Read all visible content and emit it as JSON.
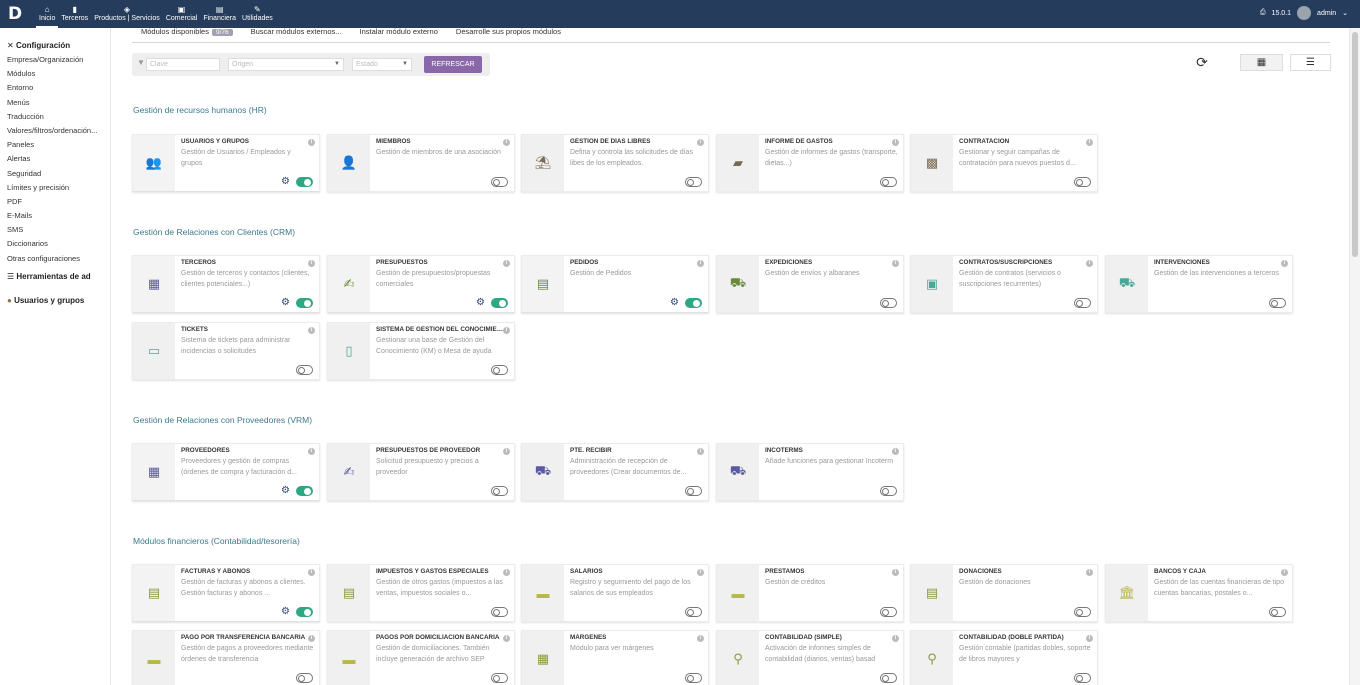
{
  "topbar": {
    "logo": "D",
    "menu": [
      {
        "label": "Inicio",
        "icon": "home-icon",
        "glyph": "⌂"
      },
      {
        "label": "Terceros",
        "icon": "building-icon",
        "glyph": "▮"
      },
      {
        "label": "Productos | Servicios",
        "icon": "cube-icon",
        "glyph": "◈"
      },
      {
        "label": "Comercial",
        "icon": "briefcase-icon",
        "glyph": "▣"
      },
      {
        "label": "Financiera",
        "icon": "money-icon",
        "glyph": "▤"
      },
      {
        "label": "Utilidades",
        "icon": "wrench-icon",
        "glyph": "✎"
      }
    ],
    "version": "15.0.1",
    "user": "admin"
  },
  "sidebar": {
    "section1_title": "Configuración",
    "items": [
      "Empresa/Organización",
      "Módulos",
      "Entorno",
      "Menús",
      "Traducción",
      "Valores/filtros/ordenación...",
      "Paneles",
      "Alertas",
      "Seguridad",
      "Límites y precisión",
      "PDF",
      "E-Mails",
      "SMS",
      "Diccionarios",
      "Otras configuraciones"
    ],
    "section2_title": "Herramientas de ad",
    "section3_title": "Usuarios y grupos"
  },
  "tabs": {
    "available": "Módulos disponibles",
    "available_count": "9/76",
    "external": "Buscar módulos externos...",
    "install": "Instalar módulo externo",
    "develop": "Desarrolle sus propios módulos"
  },
  "filters": {
    "keyword_placeholder": "Clave",
    "origin_placeholder": "Origen",
    "state_placeholder": "Estado",
    "refresh_label": "REFRESCAR"
  },
  "colors": {
    "topbar": "#263c5c",
    "accent": "#8a67a8",
    "toggle_on": "#2da882",
    "section_title": "#3d7a8a"
  },
  "sections": [
    {
      "title": "Gestión de recursos humanos (HR)",
      "cards": [
        {
          "title": "USUARIOS Y GRUPOS",
          "desc": "Gestión de Usuarios / Empleados y grupos",
          "icon": "users-icon",
          "glyph": "👥",
          "color": "#888",
          "enabled": true
        },
        {
          "title": "MIEMBROS",
          "desc": "Gestión de miembros de una asociación",
          "icon": "user-icon",
          "glyph": "👤",
          "color": "#777",
          "enabled": false
        },
        {
          "title": "GESTIÓN DE DÍAS LIBRES",
          "desc": "Defina y controla las solicitudes de días libes de los empleados.",
          "icon": "umbrella-icon",
          "glyph": "⛱",
          "color": "#7a6a52",
          "enabled": false
        },
        {
          "title": "INFORME DE GASTOS",
          "desc": "Gestión de informes de gastos (transporte, dietas...)",
          "icon": "wallet-icon",
          "glyph": "▰",
          "color": "#7a6a52",
          "enabled": false
        },
        {
          "title": "CONTRATACIÓN",
          "desc": "Gestionar y seguir campañas de contratación para nuevos puestos d...",
          "icon": "badge-icon",
          "glyph": "▩",
          "color": "#7a6a52",
          "enabled": false
        }
      ]
    },
    {
      "title": "Gestión de Relaciones con Clientes (CRM)",
      "cards": [
        {
          "title": "TERCEROS",
          "desc": "Gestión de terceros y contactos (clientes, clientes potenciales...)",
          "icon": "building-icon",
          "glyph": "▦",
          "color": "#5a5aa0",
          "enabled": true
        },
        {
          "title": "PRESUPUESTOS",
          "desc": "Gestión de presupuestos/propuestas comerciales",
          "icon": "signature-icon",
          "glyph": "✍",
          "color": "#6b8a3a",
          "enabled": true
        },
        {
          "title": "PEDIDOS",
          "desc": "Gestión de Pedidos",
          "icon": "file-icon",
          "glyph": "▤",
          "color": "#6b8a3a",
          "enabled": true
        },
        {
          "title": "EXPEDICIONES",
          "desc": "Gestión de envíos y albaranes",
          "icon": "dolly-icon",
          "glyph": "⛟",
          "color": "#6b8a3a",
          "enabled": false
        },
        {
          "title": "CONTRATOS/SUSCRIPCIONES",
          "desc": "Gestión de contratos (servicios o suscripciones recurrentes)",
          "icon": "suitcase-icon",
          "glyph": "▣",
          "color": "#4aa89a",
          "enabled": false
        },
        {
          "title": "INTERVENCIONES",
          "desc": "Gestión de las intervenciones a terceros",
          "icon": "truck-icon",
          "glyph": "⛟",
          "color": "#4aa89a",
          "enabled": false
        },
        {
          "title": "TICKETS",
          "desc": "Sistema de tickets para administrar incidencias o solicitudes",
          "icon": "ticket-icon",
          "glyph": "▭",
          "color": "#4aa89a",
          "enabled": false
        },
        {
          "title": "SISTEMA DE GESTIÓN DEL CONOCIMIENTO",
          "desc": "Gestionar una base de Gestión del Conocimiento (KM) o Mesa de ayuda",
          "icon": "mobile-icon",
          "glyph": "▯",
          "color": "#4aa89a",
          "enabled": false
        }
      ]
    },
    {
      "title": "Gestión de Relaciones con Proveedores (VRM)",
      "cards": [
        {
          "title": "PROVEEDORES",
          "desc": "Proveedores y gestión de compras (órdenes de compra y facturación d...",
          "icon": "building-icon",
          "glyph": "▦",
          "color": "#5a5aa0",
          "enabled": true
        },
        {
          "title": "PRESUPUESTOS DE PROVEEDOR",
          "desc": "Solicitud presupuesto y precios a proveedor",
          "icon": "signature-icon",
          "glyph": "✍",
          "color": "#5a5aa0",
          "enabled": false
        },
        {
          "title": "PTE. RECIBIR",
          "desc": "Administración de recepción de proveedores (Crear documentos de...",
          "icon": "dolly-icon",
          "glyph": "⛟",
          "color": "#5a5aa0",
          "enabled": false
        },
        {
          "title": "INCOTERMS",
          "desc": "Añade funciones para gestionar Incoterm",
          "icon": "truck-loading-icon",
          "glyph": "⛟",
          "color": "#5a5aa0",
          "enabled": false
        }
      ]
    },
    {
      "title": "Módulos financieros (Contabilidad/tesorería)",
      "cards": [
        {
          "title": "FACTURAS Y ABONOS",
          "desc": "Gestión de facturas y abonos a clientes. Gestión facturas y abonos ...",
          "icon": "invoice-icon",
          "glyph": "▤",
          "color": "#8a9a3a",
          "enabled": true
        },
        {
          "title": "IMPUESTOS Y GASTOS ESPECIALES",
          "desc": "Gestión de otros gastos (impuestos a las ventas, impuestos sociales o...",
          "icon": "invoice-icon",
          "glyph": "▤",
          "color": "#8a9a3a",
          "enabled": false
        },
        {
          "title": "SALARIOS",
          "desc": "Registro y seguimiento del pago de los salarios de sus empleados",
          "icon": "money-bill-icon",
          "glyph": "▬",
          "color": "#b8b84a",
          "enabled": false
        },
        {
          "title": "PRÉSTAMOS",
          "desc": "Gestión de créditos",
          "icon": "money-bill-icon",
          "glyph": "▬",
          "color": "#b8b84a",
          "enabled": false
        },
        {
          "title": "DONACIONES",
          "desc": "Gestión de donaciones",
          "icon": "file-icon",
          "glyph": "▤",
          "color": "#8a9a3a",
          "enabled": false
        },
        {
          "title": "BANCOS Y CAJA",
          "desc": "Gestión de las cuentas financieras de tipo cuentas bancarias, postales o...",
          "icon": "bank-icon",
          "glyph": "🏛",
          "color": "#b8b84a",
          "enabled": false
        },
        {
          "title": "PAGO POR TRANSFERENCIA BANCARIA",
          "desc": "Gestión de pagos a proveedores mediante órdenes de transferencia",
          "icon": "money-bill-icon",
          "glyph": "▬",
          "color": "#b8b84a",
          "enabled": false
        },
        {
          "title": "PAGOS POR DOMICILIACIÓN BANCARIA",
          "desc": "Gestión de domiciliaciones. También incluye generación de archivo SEP",
          "icon": "money-bill-icon",
          "glyph": "▬",
          "color": "#b8b84a",
          "enabled": false
        },
        {
          "title": "MÁRGENES",
          "desc": "Módulo para ver márgenes",
          "icon": "calculator-icon",
          "glyph": "▦",
          "color": "#8a9a3a",
          "enabled": false
        },
        {
          "title": "CONTABILIDAD (SIMPLE)",
          "desc": "Activación de informes simples de contabilidad (diarios, ventas) basad",
          "icon": "search-dollar-icon",
          "glyph": "⚲",
          "color": "#8a9a3a",
          "enabled": false
        },
        {
          "title": "CONTABILIDAD (DOBLE PARTIDA)",
          "desc": "Gestión contable (partidas dobles, soporte de libros mayores y",
          "icon": "search-dollar-icon",
          "glyph": "⚲",
          "color": "#8a9a3a",
          "enabled": false
        }
      ]
    }
  ]
}
